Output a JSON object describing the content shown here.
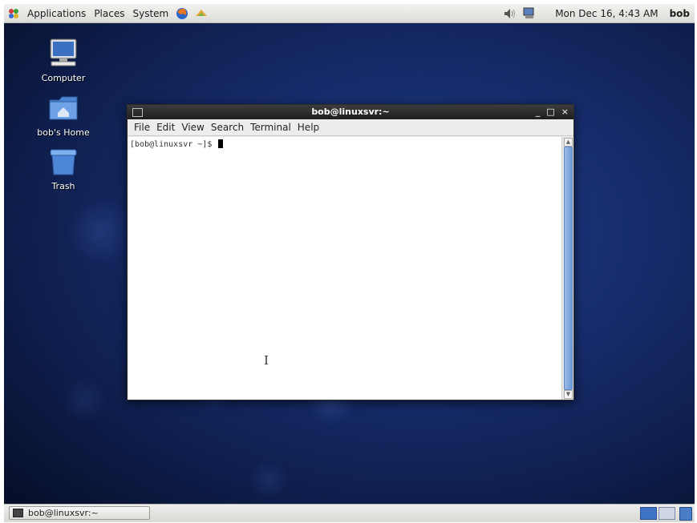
{
  "top_panel": {
    "menus": [
      "Applications",
      "Places",
      "System"
    ],
    "clock": "Mon Dec 16,  4:43 AM",
    "user": "bob",
    "icons": [
      "applications-icon",
      "firefox-icon",
      "update-icon",
      "volume-icon",
      "network-icon"
    ]
  },
  "desktop": {
    "icons": [
      {
        "label": "Computer",
        "icon": "computer-icon"
      },
      {
        "label": "bob's Home",
        "icon": "home-folder-icon"
      },
      {
        "label": "Trash",
        "icon": "trash-icon"
      }
    ]
  },
  "terminal": {
    "title": "bob@linuxsvr:~",
    "controls": [
      "_",
      "□",
      "×"
    ],
    "menu": [
      "File",
      "Edit",
      "View",
      "Search",
      "Terminal",
      "Help"
    ],
    "prompt": "[bob@linuxsvr ~]$ "
  },
  "bottom_panel": {
    "task_label": "bob@linuxsvr:~"
  }
}
